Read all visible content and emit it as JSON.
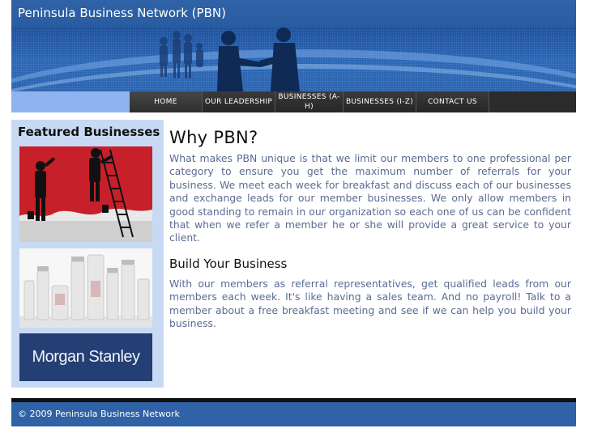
{
  "header": {
    "title": "Peninsula Business Network (PBN)"
  },
  "nav": {
    "items": [
      {
        "label": "HOME"
      },
      {
        "label": "OUR LEADERSHIP"
      },
      {
        "label": "BUSINESSES (A-H)"
      },
      {
        "label": "BUSINESSES (I-Z)"
      },
      {
        "label": "CONTACT US"
      }
    ]
  },
  "sidebar": {
    "heading": "Featured Businesses",
    "logo_text": "Morgan Stanley"
  },
  "main": {
    "heading": "Why PBN?",
    "paragraph1": "What makes PBN unique is that we limit our members to one professional per category to  ensure you get the maximum number of referrals for your business. We meet each week for breakfast and discuss each of our businesses and exchange leads for our member businesses. We only allow members in good standing to remain in our organization so each one of us can be confident that when we refer a member he or she will provide a great service to your client.",
    "subheading": "Build Your Business",
    "paragraph2": "With our members as referral representatives, get qualified leads from our members each week. It's like having a sales team. And no payroll! Talk to a member about a free breakfast meeting and see if we can help you build your business."
  },
  "footer": {
    "copyright": "© 2009 Peninsula Business Network"
  },
  "colors": {
    "header_blue": "#2f62a6",
    "nav_dark": "#2b2b2b",
    "sidebar_bg": "#c8d9f4",
    "body_text": "#5a6c93"
  }
}
